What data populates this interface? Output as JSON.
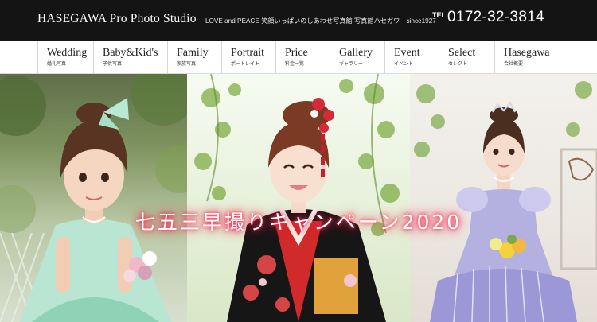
{
  "header": {
    "brand": "HASEGAWA Pro Photo Studio",
    "tagline": "LOVE and PEACE 笑顔いっぱいのしあわせ写真館 写真館ハセガワ　since1927",
    "tel_label": "TEL",
    "tel_number": "0172-32-3814",
    "background_color": "#141414"
  },
  "nav": {
    "items": [
      {
        "en": "Wedding",
        "jp": "婚礼写真"
      },
      {
        "en": "Baby&Kid's",
        "jp": "子供写真"
      },
      {
        "en": "Family",
        "jp": "家族写真"
      },
      {
        "en": "Portrait",
        "jp": "ポートレイト"
      },
      {
        "en": "Price",
        "jp": "料金一覧"
      },
      {
        "en": "Gallery",
        "jp": "ギャラリー"
      },
      {
        "en": "Event",
        "jp": "イベント"
      },
      {
        "en": "Select",
        "jp": "セレクト"
      },
      {
        "en": "Hasegawa",
        "jp": "会社概要"
      }
    ]
  },
  "hero": {
    "campaign_text": "七五三早撮りキャンペーン2020",
    "glow_color": "#ff2a4f",
    "panels": [
      "child-in-mint-dress-photo",
      "child-in-kimono-photo",
      "child-in-lavender-dress-photo"
    ]
  }
}
